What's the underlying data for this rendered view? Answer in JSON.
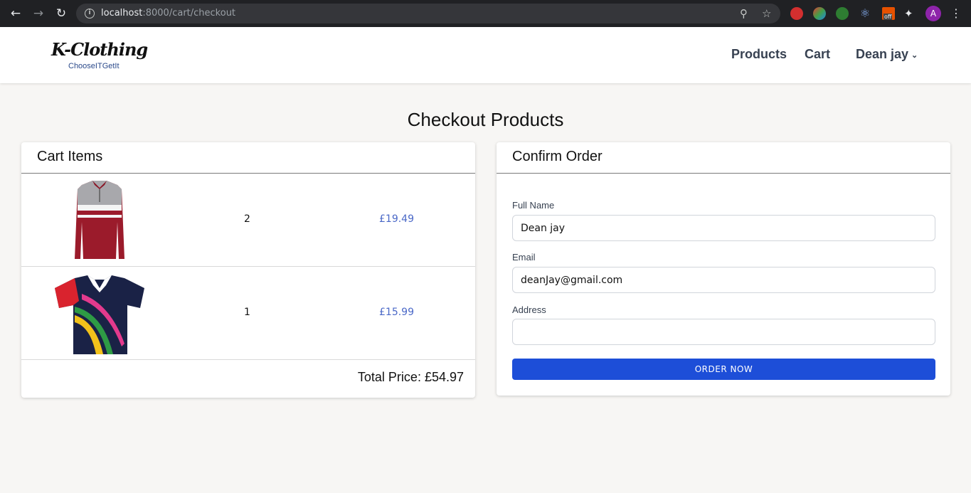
{
  "browser": {
    "url_host": "localhost",
    "url_path": ":8000/cart/checkout",
    "avatar_letter": "A",
    "icons": [
      "back-arrow-icon",
      "forward-arrow-icon",
      "reload-icon",
      "info-icon",
      "zoom-icon",
      "star-icon",
      "puzzle-icon",
      "kebab-menu-icon"
    ],
    "ext_badge": "off"
  },
  "header": {
    "logo_text": "K-Clothing",
    "logo_tagline": "ChooseITGetIt",
    "nav": {
      "products": "Products",
      "cart": "Cart",
      "user": "Dean jay"
    }
  },
  "page": {
    "title": "Checkout Products"
  },
  "cart": {
    "title": "Cart Items",
    "items": [
      {
        "qty": "2",
        "price": "£19.49",
        "image": "red-grey-striped-long-sleeve-polo"
      },
      {
        "qty": "1",
        "price": "£15.99",
        "image": "navy-multicolor-sport-polo"
      }
    ],
    "total": "Total Price: £54.97"
  },
  "order": {
    "title": "Confirm Order",
    "full_name_label": "Full Name",
    "full_name_value": "Dean jay",
    "email_label": "Email",
    "email_value": "deanJay@gmail.com",
    "address_label": "Address",
    "address_value": "",
    "button_label": "ORDER NOW"
  },
  "colors": {
    "accent": "#1d4ed8",
    "price": "#4a68c7",
    "background": "#f7f6f4",
    "chrome": "#202124"
  }
}
